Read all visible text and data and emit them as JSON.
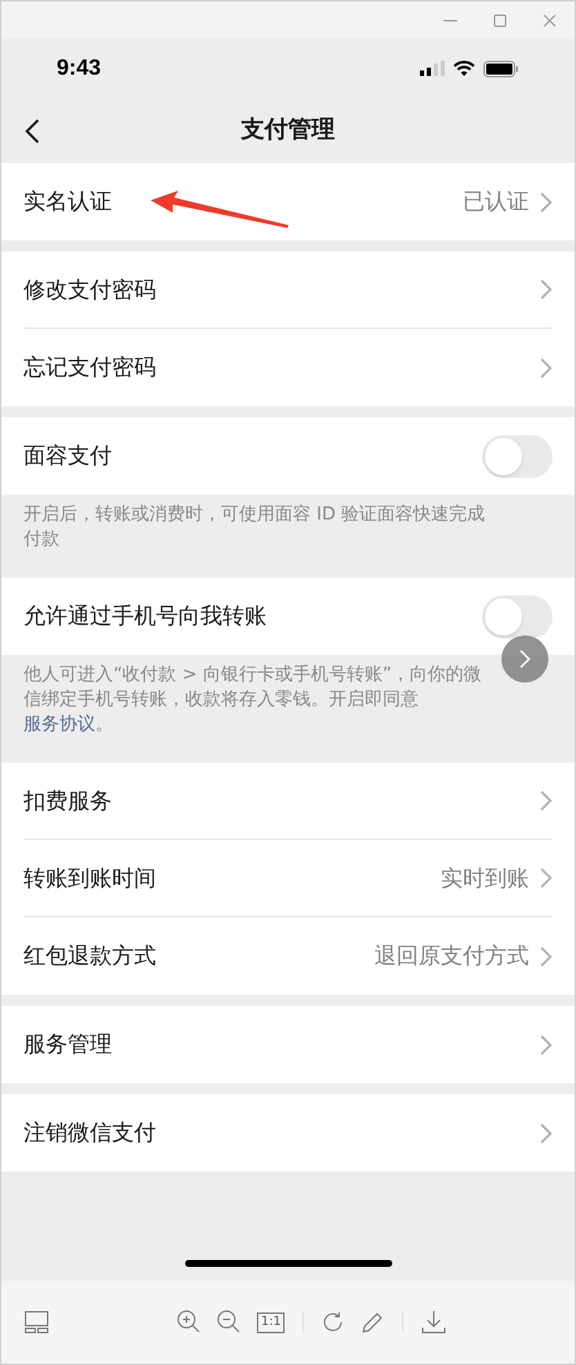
{
  "status_bar": {
    "time": "9:43"
  },
  "nav": {
    "title": "支付管理"
  },
  "groups": [
    {
      "rows": [
        {
          "kind": "link",
          "label": "实名认证",
          "value": "已认证"
        }
      ]
    },
    {
      "rows": [
        {
          "kind": "link",
          "label": "修改支付密码"
        },
        {
          "kind": "link",
          "label": "忘记支付密码"
        }
      ]
    },
    {
      "rows": [
        {
          "kind": "toggle",
          "label": "面容支付",
          "on": false
        }
      ],
      "hint": "开启后，转账或消费时，可使用面容 ID 验证面容快速完成付款"
    },
    {
      "rows": [
        {
          "kind": "toggle",
          "label": "允许通过手机号向我转账",
          "on": false
        }
      ],
      "hint": "他人可进入“收付款 > 向银行卡或手机号转账”，向你的微信绑定手机号转账，收款将存入零钱。开启即同意",
      "hint_link": "服务协议",
      "hint_end": "。"
    },
    {
      "rows": [
        {
          "kind": "link",
          "label": "扣费服务"
        },
        {
          "kind": "link",
          "label": "转账到账时间",
          "value": "实时到账"
        },
        {
          "kind": "link",
          "label": "红包退款方式",
          "value": "退回原支付方式"
        }
      ]
    },
    {
      "rows": [
        {
          "kind": "link",
          "label": "服务管理"
        }
      ]
    },
    {
      "rows": [
        {
          "kind": "link",
          "label": "注销微信支付"
        }
      ]
    }
  ],
  "toolbar": {
    "ratio_label": "1:1"
  }
}
